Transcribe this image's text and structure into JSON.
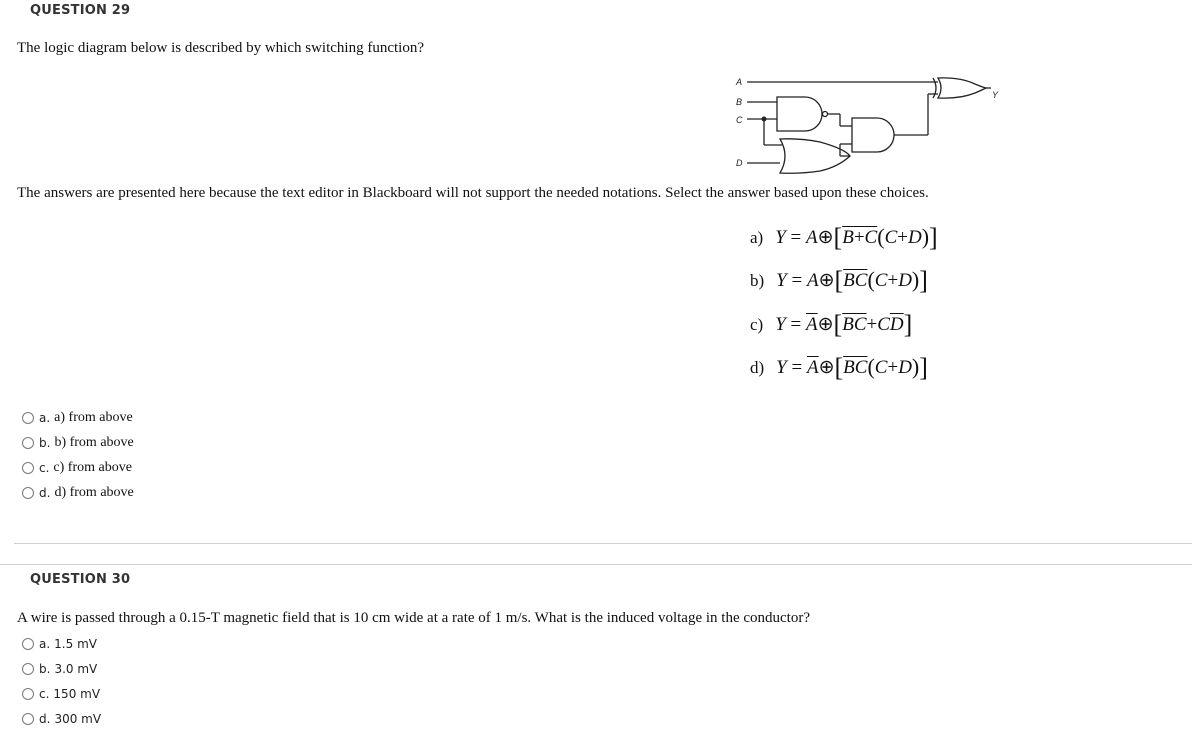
{
  "q29": {
    "title": "QUESTION 29",
    "prompt": "The logic diagram below is described by which switching function?",
    "diagram": {
      "inputs": [
        "A",
        "B",
        "C",
        "D"
      ],
      "output": "Y",
      "gates": [
        "NAND(B,C)",
        "OR(C,D)",
        "AND",
        "XOR(A, ...)"
      ]
    },
    "note": "The answers are presented here because the text editor in Blackboard will not support the needed notations.  Select the answer based upon these choices.",
    "choices": [
      {
        "label": "a)",
        "equation": "Y = A ⊕ [ (B+C)' (C+D) ]"
      },
      {
        "label": "b)",
        "equation": "Y = A ⊕ [ (BC)' (C+D) ]"
      },
      {
        "label": "c)",
        "equation": "Y = A' ⊕ [ (BC)' + CD' ]"
      },
      {
        "label": "d)",
        "equation": "Y = A' ⊕ [ (BC)' (C+D) ]"
      }
    ],
    "options": [
      {
        "letter": "a.",
        "text": "a) from above"
      },
      {
        "letter": "b.",
        "text": "b) from above"
      },
      {
        "letter": "c.",
        "text": "c) from above"
      },
      {
        "letter": "d.",
        "text": "d) from above"
      }
    ]
  },
  "q30": {
    "title": "QUESTION 30",
    "prompt": "A wire is passed through a 0.15-T magnetic field that is 10 cm wide at a rate of 1 m/s. What is the induced voltage in the conductor?",
    "options": [
      {
        "letter": "a.",
        "text": "1.5 mV"
      },
      {
        "letter": "b.",
        "text": "3.0 mV"
      },
      {
        "letter": "c.",
        "text": "150 mV"
      },
      {
        "letter": "d.",
        "text": "300 mV"
      }
    ]
  },
  "eq_parts": {
    "Y": "Y",
    "eq": " = ",
    "A": "A",
    "xor": "⊕",
    "B": "B",
    "C": "C",
    "D": "D",
    "plus": "+",
    "lb": "[",
    "rb": "]",
    "lp": "(",
    "rp": ")"
  }
}
